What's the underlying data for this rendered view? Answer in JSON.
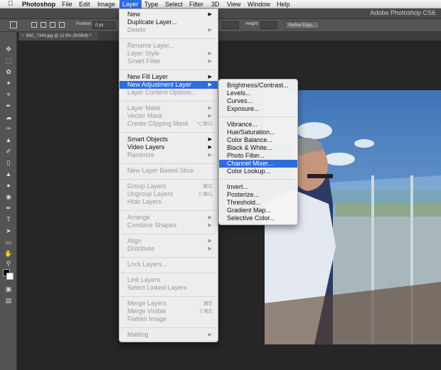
{
  "menubar": {
    "items": [
      "Photoshop",
      "File",
      "Edit",
      "Image",
      "Layer",
      "Type",
      "Select",
      "Filter",
      "3D",
      "View",
      "Window",
      "Help"
    ]
  },
  "appbar": {
    "title": "Adobe Photoshop CS6"
  },
  "options": {
    "feather_label": "Feather:",
    "feather_value": "0 px",
    "height_label": "Height:",
    "refine_edge": "Refine Edge..."
  },
  "document_tab": {
    "title": "IMG_7344.jpg @ 12.5% (RGB/8) *"
  },
  "layer_menu": {
    "items": [
      {
        "label": "New",
        "submenu": true
      },
      {
        "label": "Duplicate Layer..."
      },
      {
        "label": "Delete",
        "disabled": true,
        "submenu": true
      },
      {
        "label": "Rename Layer...",
        "disabled": true
      },
      {
        "label": "Layer Style",
        "disabled": true,
        "submenu": true
      },
      {
        "label": "Smart Filter",
        "disabled": true,
        "submenu": true
      },
      {
        "label": "New Fill Layer",
        "submenu": true
      },
      {
        "label": "New Adjustment Layer",
        "submenu": true,
        "highlighted": true
      },
      {
        "label": "Layer Content Options...",
        "disabled": true
      },
      {
        "label": "Layer Mask",
        "disabled": true,
        "submenu": true
      },
      {
        "label": "Vector Mask",
        "disabled": true,
        "submenu": true
      },
      {
        "label": "Create Clipping Mask",
        "disabled": true,
        "shortcut": "⌥⌘G"
      },
      {
        "label": "Smart Objects",
        "submenu": true
      },
      {
        "label": "Video Layers",
        "submenu": true
      },
      {
        "label": "Rasterize",
        "disabled": true,
        "submenu": true
      },
      {
        "label": "New Layer Based Slice",
        "disabled": true
      },
      {
        "label": "Group Layers",
        "disabled": true,
        "shortcut": "⌘G"
      },
      {
        "label": "Ungroup Layers",
        "disabled": true,
        "shortcut": "⇧⌘G"
      },
      {
        "label": "Hide Layers",
        "disabled": true
      },
      {
        "label": "Arrange",
        "disabled": true,
        "submenu": true
      },
      {
        "label": "Combine Shapes",
        "disabled": true,
        "submenu": true
      },
      {
        "label": "Align",
        "disabled": true,
        "submenu": true
      },
      {
        "label": "Distribute",
        "disabled": true,
        "submenu": true
      },
      {
        "label": "Lock Layers...",
        "disabled": true
      },
      {
        "label": "Link Layers",
        "disabled": true
      },
      {
        "label": "Select Linked Layers",
        "disabled": true
      },
      {
        "label": "Merge Layers",
        "disabled": true,
        "shortcut": "⌘E"
      },
      {
        "label": "Merge Visible",
        "disabled": true,
        "shortcut": "⇧⌘E"
      },
      {
        "label": "Flatten Image",
        "disabled": true
      },
      {
        "label": "Matting",
        "disabled": true,
        "submenu": true
      }
    ]
  },
  "adjustment_menu": {
    "items": [
      {
        "label": "Brightness/Contrast..."
      },
      {
        "label": "Levels..."
      },
      {
        "label": "Curves..."
      },
      {
        "label": "Exposure..."
      },
      {
        "label": "Vibrance..."
      },
      {
        "label": "Hue/Saturation..."
      },
      {
        "label": "Color Balance..."
      },
      {
        "label": "Black & White..."
      },
      {
        "label": "Photo Filter..."
      },
      {
        "label": "Channel Mixer...",
        "highlighted": true
      },
      {
        "label": "Color Lookup..."
      },
      {
        "label": "Invert..."
      },
      {
        "label": "Posterize..."
      },
      {
        "label": "Threshold..."
      },
      {
        "label": "Gradient Map..."
      },
      {
        "label": "Selective Color..."
      }
    ]
  },
  "colors": {
    "highlight": "#2f6ce0",
    "panel": "#535353",
    "canvas_bg": "#262626"
  }
}
